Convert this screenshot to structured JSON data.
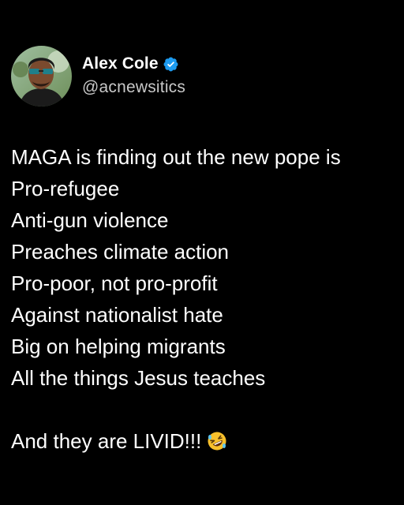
{
  "post": {
    "author": {
      "name": "Alex Cole",
      "handle": "@acnewsitics",
      "verified_icon": "verified-badge-icon",
      "avatar_icon": "profile-photo",
      "verified_color": "#1d9bf0"
    },
    "lines": [
      "MAGA is finding out the new pope is",
      "Pro-refugee",
      "Anti-gun violence",
      "Preaches climate action",
      "Pro-poor, not pro-profit",
      "Against nationalist hate",
      "Big on helping migrants",
      "All the things Jesus teaches"
    ],
    "closing": "And they are LIVID!!!",
    "closing_emoji": "rolling-on-floor-laughing-emoji"
  },
  "colors": {
    "background": "#000000",
    "text": "#ffffff",
    "handle": "#c8c8c8",
    "accent": "#1d9bf0"
  }
}
